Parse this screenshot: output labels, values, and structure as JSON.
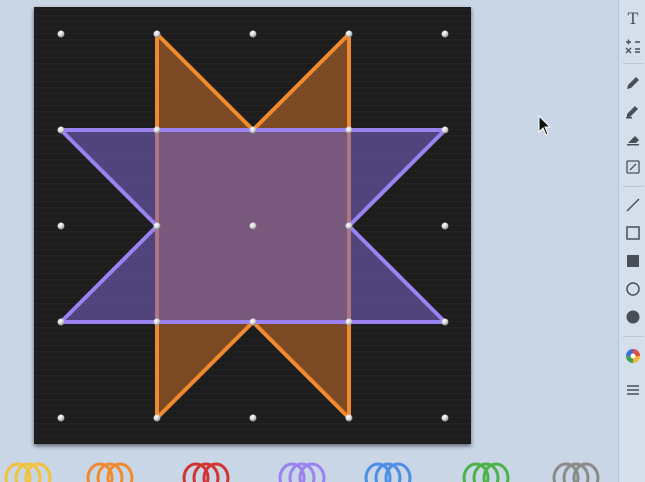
{
  "app": {
    "colors": {
      "background": "#c9d6e6",
      "board": "#1d1d1d",
      "peg": "#e4e4e4",
      "orange_band": "#f08a2e",
      "purple_band": "#9a82f0"
    }
  },
  "geoboard": {
    "grid_size": 5,
    "shapes": [
      {
        "name": "orange-star-band",
        "color": "#f08a2e",
        "fill": "rgba(200,110,40,0.55)",
        "points": [
          [
            1,
            0
          ],
          [
            2,
            1
          ],
          [
            3,
            0
          ],
          [
            3,
            4
          ],
          [
            2,
            3
          ],
          [
            1,
            4
          ]
        ]
      },
      {
        "name": "purple-star-band",
        "color": "#9a82f0",
        "fill": "rgba(120,100,200,0.55)",
        "points": [
          [
            0,
            1
          ],
          [
            4,
            1
          ],
          [
            3,
            2
          ],
          [
            4,
            3
          ],
          [
            0,
            3
          ],
          [
            1,
            2
          ]
        ]
      }
    ],
    "center_peg": [
      2,
      2
    ]
  },
  "toolbar": {
    "text_tool": "T",
    "tools": [
      "text-icon",
      "calculator-icon",
      "pen-icon",
      "marker-icon",
      "eraser-icon",
      "edit-note-icon",
      "line-icon",
      "rectangle-outline-icon",
      "rectangle-filled-icon",
      "circle-outline-icon",
      "circle-filled-icon",
      "color-palette-icon",
      "menu-icon"
    ]
  },
  "bands_tray": {
    "colors": [
      "#f2c23a",
      "#f08a2e",
      "#d23434",
      "#9a82f0",
      "#4f8ee6",
      "#4cb24a",
      "#8a8a8a"
    ]
  }
}
